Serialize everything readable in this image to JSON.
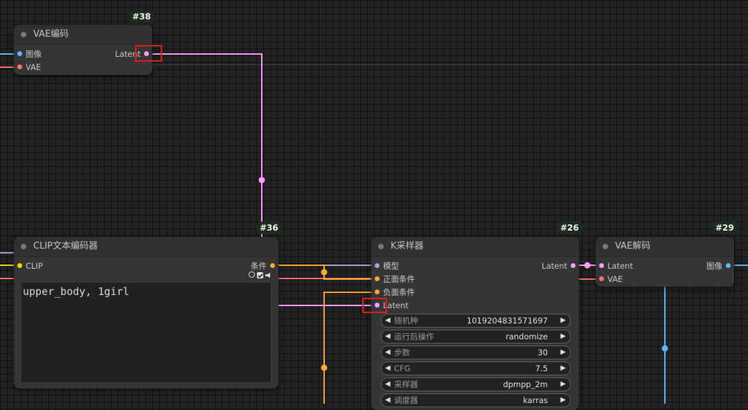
{
  "nodes": {
    "vae_encode": {
      "id": "#38",
      "title": "VAE编码",
      "inputs": [
        "图像",
        "VAE"
      ],
      "output": "Latent"
    },
    "clip_encode": {
      "id": "#36",
      "title": "CLIP文本编码器",
      "input": "CLIP",
      "output": "条件",
      "text": "upper_body, 1girl"
    },
    "ksampler": {
      "id": "#26",
      "title": "K采样器",
      "inputs": [
        "模型",
        "正面条件",
        "负面条件",
        "Latent"
      ],
      "output": "Latent",
      "widgets": [
        {
          "label": "随机种",
          "value": "1019204831571697"
        },
        {
          "label": "运行后操作",
          "value": "randomize"
        },
        {
          "label": "步数",
          "value": "30"
        },
        {
          "label": "CFG",
          "value": "7.5"
        },
        {
          "label": "采样器",
          "value": "dpmpp_2m"
        },
        {
          "label": "调度器",
          "value": "karras"
        }
      ]
    },
    "vae_decode": {
      "id": "#29",
      "title": "VAE解码",
      "inputs": [
        "Latent",
        "VAE"
      ],
      "output": "图像"
    }
  },
  "colors": {
    "latent": "#ff9cf9",
    "image": "#64b5f6",
    "vae": "#ff6e6e",
    "clip": "#ffd500",
    "conditioning": "#ffa931",
    "model": "#b39ddb",
    "highlight": "#e02020"
  }
}
